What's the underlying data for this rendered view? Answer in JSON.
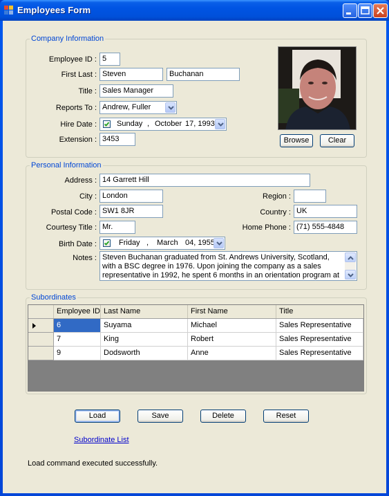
{
  "window": {
    "title": "Employees Form",
    "controls": [
      "minimize",
      "maximize",
      "close"
    ]
  },
  "company": {
    "legend": "Company Information",
    "employee_id_label": "Employee ID :",
    "employee_id": "5",
    "first_last_label": "First Last :",
    "first_name": "Steven",
    "last_name": "Buchanan",
    "title_label": "Title :",
    "title": "Sales Manager",
    "reports_to_label": "Reports To :",
    "reports_to": "Andrew, Fuller",
    "hire_date_label": "Hire Date :",
    "hire_date": {
      "checked": true,
      "weekday": "Sunday",
      "sep": ",",
      "month": "October",
      "day_year": "17, 1993"
    },
    "extension_label": "Extension :",
    "extension": "3453",
    "photo_alt": "Employee photo",
    "browse_label": "Browse",
    "clear_label": "Clear"
  },
  "personal": {
    "legend": "Personal Information",
    "address_label": "Address :",
    "address": "14 Garrett Hill",
    "city_label": "City :",
    "city": "London",
    "region_label": "Region :",
    "region": "",
    "postal_label": "Postal Code :",
    "postal": "SW1 8JR",
    "country_label": "Country :",
    "country": "UK",
    "courtesy_label": "Courtesy Title :",
    "courtesy": "Mr.",
    "phone_label": "Home Phone :",
    "phone": "(71) 555-4848",
    "birth_label": "Birth Date :",
    "birth_date": {
      "checked": true,
      "weekday": "Friday",
      "sep": ",",
      "month": "March",
      "day_year": "04, 1955"
    },
    "notes_label": "Notes :",
    "notes": "Steven Buchanan graduated from St. Andrews University, Scotland, with a BSC degree in 1976.  Upon joining the company as a sales representative in 1992, he spent 6 months in an orientation program at the Seattle office and then returned to"
  },
  "subordinates": {
    "legend": "Subordinates",
    "columns": [
      "Employee ID",
      "Last Name",
      "First Name",
      "Title"
    ],
    "rows": [
      [
        "6",
        "Suyama",
        "Michael",
        "Sales Representative"
      ],
      [
        "7",
        "King",
        "Robert",
        "Sales Representative"
      ],
      [
        "9",
        "Dodsworth",
        "Anne",
        "Sales Representative"
      ]
    ],
    "selected_row": 0
  },
  "actions": {
    "load": "Load",
    "save": "Save",
    "delete": "Delete",
    "reset": "Reset"
  },
  "link": "Subordinate List",
  "status": "Load command executed successfully.",
  "colors": {
    "titlebar": "#0054e3",
    "background": "#ece9d8",
    "legend": "#0046d5",
    "selection": "#316ac5",
    "link": "#0000cc"
  }
}
